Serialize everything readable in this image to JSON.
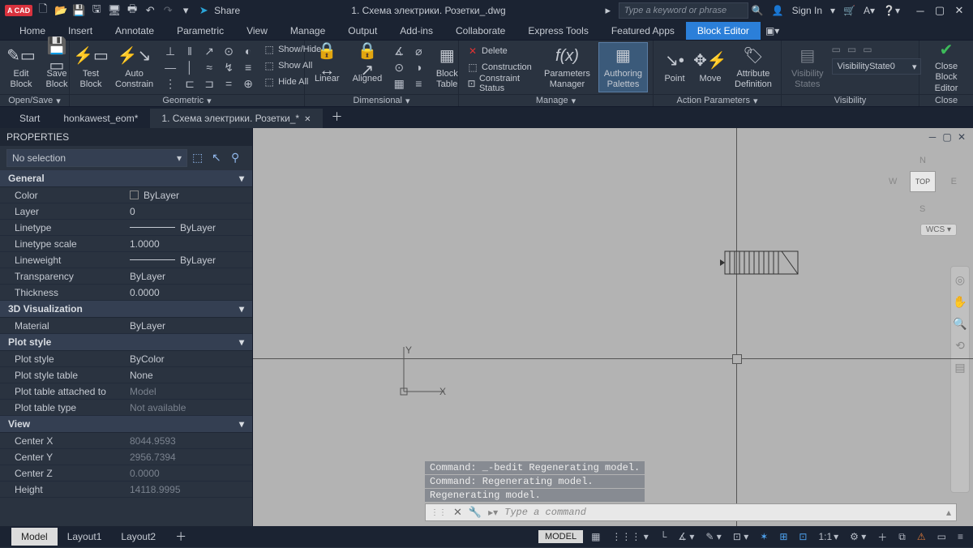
{
  "titlebar": {
    "logo": "A CAD",
    "share": "Share",
    "title": "1. Схема электрики. Розетки_.dwg",
    "search_placeholder": "Type a keyword or phrase",
    "signin": "Sign In"
  },
  "menubar": {
    "items": [
      "Home",
      "Insert",
      "Annotate",
      "Parametric",
      "View",
      "Manage",
      "Output",
      "Add-ins",
      "Collaborate",
      "Express Tools",
      "Featured Apps",
      "Block Editor"
    ]
  },
  "ribbon": {
    "opensave": {
      "edit": "Edit\nBlock",
      "save": "Save\nBlock",
      "title": "Open/Save"
    },
    "autoconstrain": {
      "test": "Test\nBlock",
      "auto": "Auto\nConstrain",
      "show_hide": "Show/Hide",
      "show_all": "Show All",
      "hide_all": "Hide All",
      "title": "Geometric"
    },
    "dimensional": {
      "linear": "Linear",
      "aligned": "Aligned",
      "block_table": "Block\nTable",
      "title": "Dimensional"
    },
    "manage": {
      "delete": "Delete",
      "construction": "Construction",
      "constraint_status": "Constraint Status",
      "param_mgr": "Parameters\nManager",
      "auth_pal": "Authoring\nPalettes",
      "title": "Manage"
    },
    "action_params": {
      "point": "Point",
      "move": "Move",
      "attr_def": "Attribute\nDefinition",
      "title": "Action Parameters"
    },
    "visibility": {
      "vis_states": "Visibility\nStates",
      "combo": "VisibilityState0",
      "title": "Visibility"
    },
    "close": {
      "close_be": "Close\nBlock Editor",
      "title": "Close"
    }
  },
  "doctabs": {
    "tabs": [
      "Start",
      "honkawest_eom*",
      "1. Схема электрики. Розетки_*"
    ]
  },
  "properties": {
    "title": "PROPERTIES",
    "selector": "No selection",
    "sections": {
      "general": {
        "title": "General",
        "rows": [
          {
            "k": "Color",
            "v": "ByLayer",
            "swatch": true
          },
          {
            "k": "Layer",
            "v": "0"
          },
          {
            "k": "Linetype",
            "v": "ByLayer",
            "line": true
          },
          {
            "k": "Linetype scale",
            "v": "1.0000"
          },
          {
            "k": "Lineweight",
            "v": "ByLayer",
            "line": true
          },
          {
            "k": "Transparency",
            "v": "ByLayer"
          },
          {
            "k": "Thickness",
            "v": "0.0000"
          }
        ]
      },
      "viz3d": {
        "title": "3D Visualization",
        "rows": [
          {
            "k": "Material",
            "v": "ByLayer"
          }
        ]
      },
      "plot": {
        "title": "Plot style",
        "rows": [
          {
            "k": "Plot style",
            "v": "ByColor"
          },
          {
            "k": "Plot style table",
            "v": "None"
          },
          {
            "k": "Plot table attached to",
            "v": "Model",
            "dim": true
          },
          {
            "k": "Plot table type",
            "v": "Not available",
            "dim": true
          }
        ]
      },
      "view": {
        "title": "View",
        "rows": [
          {
            "k": "Center X",
            "v": "8044.9593",
            "dim": true
          },
          {
            "k": "Center Y",
            "v": "2956.7394",
            "dim": true
          },
          {
            "k": "Center Z",
            "v": "0.0000",
            "dim": true
          },
          {
            "k": "Height",
            "v": "14118.9995",
            "dim": true
          }
        ]
      }
    }
  },
  "canvas": {
    "viewcube": {
      "top": "TOP",
      "n": "N",
      "s": "S",
      "e": "E",
      "w": "W"
    },
    "wcs": "WCS",
    "ucs": {
      "x": "X",
      "y": "Y"
    },
    "cmd_history": [
      "Command: _-bedit Regenerating model.",
      "Command: Regenerating model.",
      "Regenerating model."
    ],
    "cmd_placeholder": "Type a command"
  },
  "bottom": {
    "tabs": [
      "Model",
      "Layout1",
      "Layout2"
    ],
    "model_btn": "MODEL",
    "scale": "1:1"
  }
}
